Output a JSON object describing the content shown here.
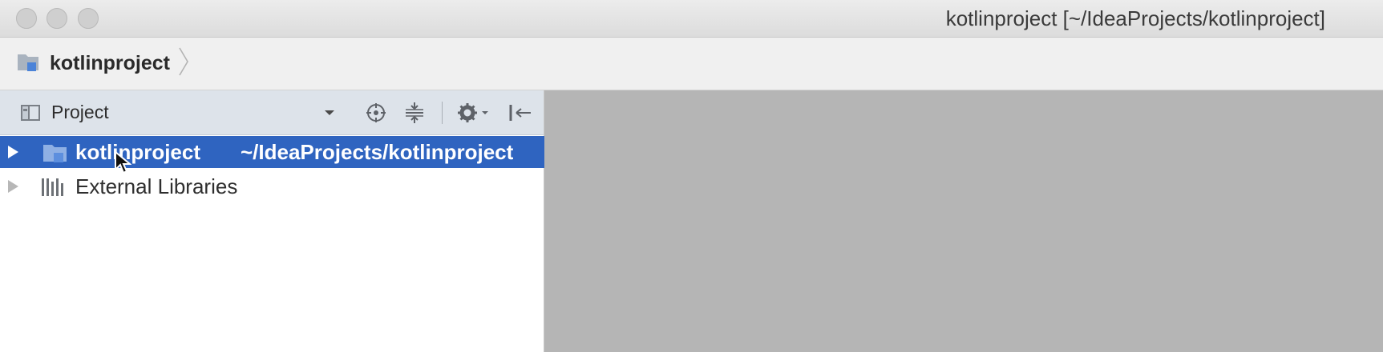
{
  "window": {
    "title": "kotlinproject [~/IdeaProjects/kotlinproject]",
    "buttons": [
      "close",
      "minimize",
      "zoom"
    ]
  },
  "navbar": {
    "breadcrumb": "kotlinproject",
    "icon": "project-folder-icon"
  },
  "project_panel": {
    "header": {
      "title": "Project",
      "icons": [
        "project-view-icon",
        "dropdown-icon",
        "locate-icon",
        "collapse-all-icon",
        "gear-icon",
        "hide-panel-icon"
      ]
    },
    "tree": [
      {
        "name": "kotlinproject",
        "path": "~/IdeaProjects/kotlinproject",
        "icon": "project-folder-icon",
        "selected": true
      },
      {
        "name": "External Libraries",
        "icon": "libraries-icon",
        "selected": false
      }
    ]
  },
  "colors": {
    "selection": "#2f64c0",
    "editor_background": "#b5b5b5",
    "panel_header": "#dde3ea"
  }
}
